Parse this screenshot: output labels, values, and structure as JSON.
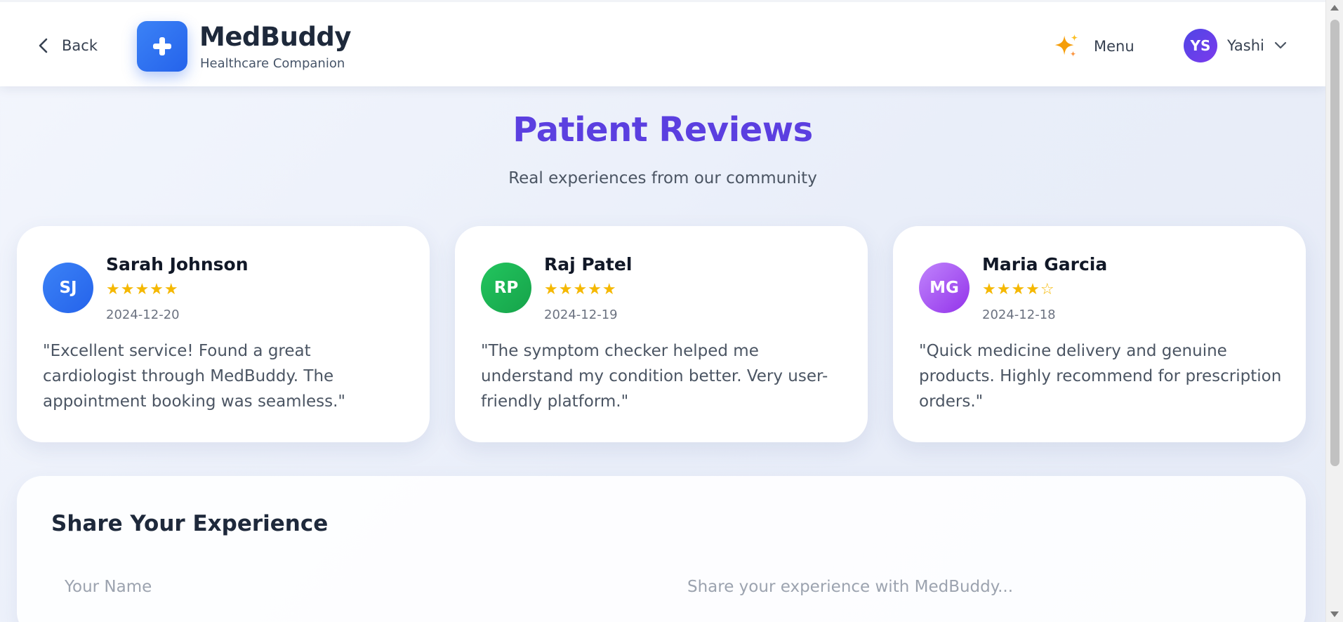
{
  "header": {
    "back_label": "Back",
    "brand_name": "MedBuddy",
    "brand_tagline": "Healthcare Companion",
    "menu_label": "Menu",
    "user": {
      "initials": "YS",
      "name": "Yashi"
    }
  },
  "hero": {
    "title": "Patient Reviews",
    "subtitle": "Real experiences from our community"
  },
  "reviews": [
    {
      "initials": "SJ",
      "name": "Sarah Johnson",
      "rating": 5,
      "stars": "★★★★★",
      "date": "2024-12-20",
      "text": "\"Excellent service! Found a great cardiologist through MedBuddy. The appointment booking was seamless.\"",
      "avatar_color": "#3b82f6"
    },
    {
      "initials": "RP",
      "name": "Raj Patel",
      "rating": 5,
      "stars": "★★★★★",
      "date": "2024-12-19",
      "text": "\"The symptom checker helped me understand my condition better. Very user-friendly platform.\"",
      "avatar_color": "#22c55e"
    },
    {
      "initials": "MG",
      "name": "Maria Garcia",
      "rating": 4,
      "stars": "★★★★☆",
      "date": "2024-12-18",
      "text": "\"Quick medicine delivery and genuine products. Highly recommend for prescription orders.\"",
      "avatar_color": "#a855f7"
    }
  ],
  "share_form": {
    "title": "Share Your Experience",
    "name_placeholder": "Your Name",
    "name_value": "",
    "experience_placeholder": "Share your experience with MedBuddy...",
    "experience_value": ""
  },
  "colors": {
    "brand_blue": "#2563eb",
    "title_purple": "#5b3fe0",
    "star_gold": "#f5b800"
  },
  "icons": {
    "back": "chevron-left-icon",
    "logo": "medical-cross-icon",
    "menu": "sparkles-icon",
    "user_dropdown": "chevron-down-icon"
  }
}
